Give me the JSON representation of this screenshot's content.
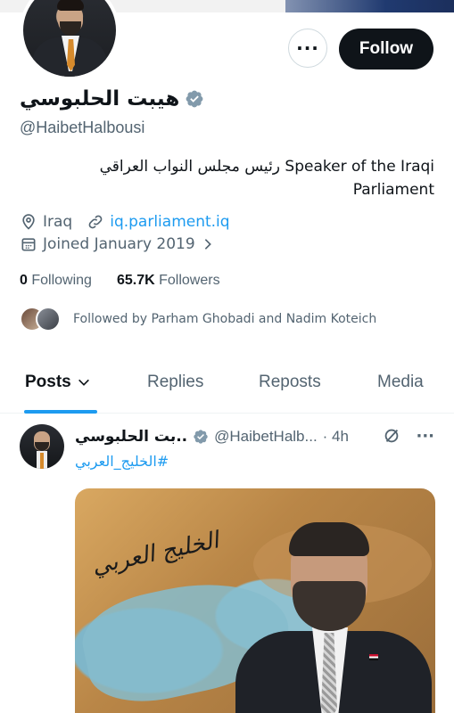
{
  "header": {
    "follow_label": "Follow",
    "more_label": "···"
  },
  "profile": {
    "display_name": "هيبت الحلبوسي",
    "handle": "@HaibetHalbousi",
    "bio_line1": "رئيس مجلس النواب العراقي Speaker of the Iraqi",
    "bio_line2": "Parliament",
    "location": "Iraq",
    "website": "iq.parliament.iq",
    "joined": "Joined January 2019",
    "following_count": "0",
    "following_label": "Following",
    "followers_count": "65.7K",
    "followers_label": "Followers",
    "followed_by": "Followed by Parham Ghobadi and Nadim Koteich"
  },
  "tabs": [
    "Posts",
    "Replies",
    "Reposts",
    "Media"
  ],
  "post": {
    "name": "..بت الحلبوسي",
    "handle": "@HaibetHalb...",
    "time": "· 4h",
    "hashtag": "#الخليج_العربي",
    "image_caption": "الخليج العربي"
  },
  "colors": {
    "accent": "#1d9bf0",
    "text": "#0f1419",
    "muted": "#536471"
  }
}
